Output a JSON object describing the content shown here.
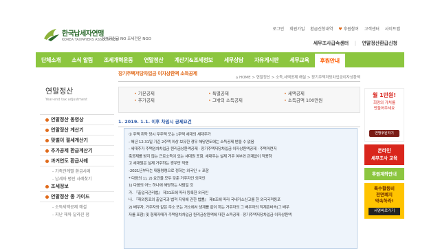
{
  "header": {
    "logo_main": "한국납세자연맹",
    "logo_sub": "KOREA TAXPAYERS ASSOCIATION",
    "logo_tag": "정부지원금 NO 조세전문 NGO",
    "top_links": [
      "로그인",
      "회원가입",
      "환급신청내역",
      "후원참여",
      "고객센터",
      "사이트맵"
    ],
    "sub_links": [
      "세무조사급속센터",
      "연말정산환급신청"
    ]
  },
  "mainnav": [
    "단체소개",
    "소식 알림",
    "조세개혁운동",
    "연말정산",
    "계산기&조세정보",
    "세무상담",
    "자유게시판",
    "세무교육",
    "후원안내"
  ],
  "sidebar": {
    "title": "연말정산",
    "eng": "Year-end tax adjustment",
    "items": [
      {
        "label": "연말정산 동영상",
        "type": "main"
      },
      {
        "label": "연말정산 계산기",
        "type": "main"
      },
      {
        "label": "맞벌이 절세계산기",
        "type": "main"
      },
      {
        "label": "추가공제 환급계산기",
        "type": "main"
      },
      {
        "label": "과거연도 환급사례",
        "type": "main"
      },
      {
        "label": "- 가족관계별 환급사례",
        "type": "sub"
      },
      {
        "label": "- 납세자 평진 사례찾기",
        "type": "sub"
      },
      {
        "label": "조세정보",
        "type": "main"
      },
      {
        "label": "연말정산 종 가이드",
        "type": "main"
      },
      {
        "label": "- 소득세액공제 해설",
        "type": "sub"
      },
      {
        "label": "- 지난 해와 달라진 점",
        "type": "sub"
      }
    ]
  },
  "content": {
    "title": "장기주택저당차입금 이자상환액 소득공제",
    "breadcrumb": "HOME > 연말정산 > 소득,세액공제 해설 > 장기주택저당차입금이자상환액",
    "features": {
      "col1": [
        "기본공제",
        "추가공제"
      ],
      "col2": [
        "특별공제",
        "그밖의 소득공제"
      ],
      "col3": [
        "세액공제",
        "소득금액 100만원"
      ]
    },
    "dateline": "1. 2019. 1.1. 이후 차입시 공제요건",
    "lines": [
      "① 주택 취득 당시 무주택 또는 1주택 세대의 세대주가",
      "   - 해년 12.31일 기준 2주택 이상 보유한 경우 해당연도에는 소득공제 받을 수 없음",
      "   - 세대주가 주택임차차입금 원리금상환액공제 · 장기주택저당차입금 이자상환액공제 · 주택마련저",
      "   축공제를 받지 않는 근로소득이 있는 세대원 포함. 세대주는 실제 거주 여부와 관계없이 적용하",
      "   고 세대원은 실제 거주하는 경우만 적용",
      "   -2021년부터는 대통령령으로 정하는 외국인 + 포함",
      "   * 다음의 1), 2) 요건을 모두 갖춘 거주자인 외국인",
      "   1) 다음의 어느 하나에 해당하는 사람일 것",
      "   가. 『출입국관리법』 제31조에 따라 등록한 외국인",
      "   나. 『재외동포의 출입국과 법적 지위에 관한 법률』 제6조에 따라 국내거소신고를 한 외국국적동포",
      "   2) 배우자, 거주자와 같은 주소 또는 거소에서 생계를 같이 하는 거주자의 그 배우자의 직계존비속(그 배우",
      "   자를 포함) 및 형제자매가 주택임차차입금 원리금상환액에 대한 소득공제 · 장기주택저당차입금 이자상환액"
    ]
  },
  "right": {
    "banner1_big": "월 1만원!",
    "banner1_txt": [
      "희망의 가치를",
      "만들어주세요"
    ],
    "banner1_btn": "연맹후원하기",
    "banner2_a": "온라인",
    "banner2_b": "세무조사 교육",
    "banner3": "후원계좌안내",
    "banner4_t": [
      "특수활동비",
      "전면폐지",
      "약속하라!"
    ],
    "banner4_btn": "서명바로가기"
  },
  "colors": {
    "accent_green": "#8cc63f",
    "accent_orange": "#e06a1a",
    "blue_text": "#2b58a6"
  }
}
